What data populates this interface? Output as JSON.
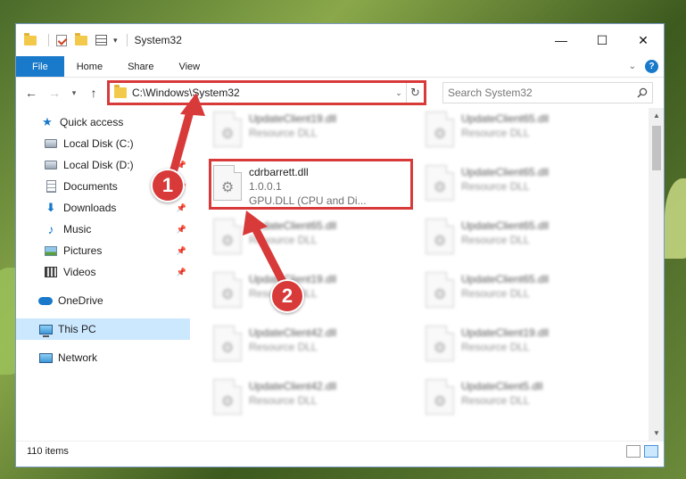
{
  "window": {
    "title": "System32",
    "controls": {
      "minimize": "—",
      "maximize": "☐",
      "close": "✕"
    }
  },
  "ribbon": {
    "tabs": [
      "File",
      "Home",
      "Share",
      "View"
    ],
    "collapse_icon": "chevron-down-icon",
    "help": "?"
  },
  "nav": {
    "back": "←",
    "forward": "→",
    "recent": "▾",
    "up": "↑",
    "address": "C:\\Windows\\System32",
    "refresh": "↻",
    "search_placeholder": "Search System32"
  },
  "sidebar": {
    "items": [
      {
        "label": "Quick access",
        "icon": "star-icon",
        "pinned": false
      },
      {
        "label": "Local Disk (C:)",
        "icon": "drive-icon",
        "pinned": true
      },
      {
        "label": "Local Disk (D:)",
        "icon": "drive-icon",
        "pinned": true
      },
      {
        "label": "Documents",
        "icon": "documents-icon",
        "pinned": true
      },
      {
        "label": "Downloads",
        "icon": "downloads-icon",
        "pinned": true
      },
      {
        "label": "Music",
        "icon": "music-icon",
        "pinned": true
      },
      {
        "label": "Pictures",
        "icon": "pictures-icon",
        "pinned": true
      },
      {
        "label": "Videos",
        "icon": "videos-icon",
        "pinned": true
      },
      {
        "label": "OneDrive",
        "icon": "onedrive-icon",
        "pinned": false
      },
      {
        "label": "This PC",
        "icon": "this-pc-icon",
        "pinned": false,
        "selected": true
      },
      {
        "label": "Network",
        "icon": "network-icon",
        "pinned": false
      }
    ],
    "pin_glyph": "📌"
  },
  "files": {
    "highlighted": {
      "name": "cdrbarrett.dll",
      "version": "1.0.0.1",
      "description": "GPU.DLL (CPU and Di..."
    },
    "blurred_left": [
      {
        "name": "UpdateClient19.dll",
        "type": "Resource DLL"
      },
      {
        "name": "UpdateClient65.dll",
        "type": "Resource DLL"
      },
      {
        "name": "UpdateClient19.dll",
        "type": "Resource DLL"
      },
      {
        "name": "UpdateClient42.dll",
        "type": "Resource DLL"
      },
      {
        "name": "UpdateClient42.dll",
        "type": "Resource DLL"
      }
    ],
    "blurred_right": [
      {
        "name": "UpdateClient65.dll",
        "type": "Resource DLL"
      },
      {
        "name": "UpdateClient65.dll",
        "type": "Resource DLL"
      },
      {
        "name": "UpdateClient65.dll",
        "type": "Resource DLL"
      },
      {
        "name": "UpdateClient65.dll",
        "type": "Resource DLL"
      },
      {
        "name": "UpdateClient19.dll",
        "type": "Resource DLL"
      },
      {
        "name": "UpdateClient5.dll",
        "type": "Resource DLL"
      }
    ]
  },
  "status": {
    "count": "110 items"
  },
  "callouts": {
    "one": "1",
    "two": "2"
  },
  "colors": {
    "accent": "#1979ca",
    "highlight": "#d83a3a",
    "selected": "#cce8ff"
  }
}
